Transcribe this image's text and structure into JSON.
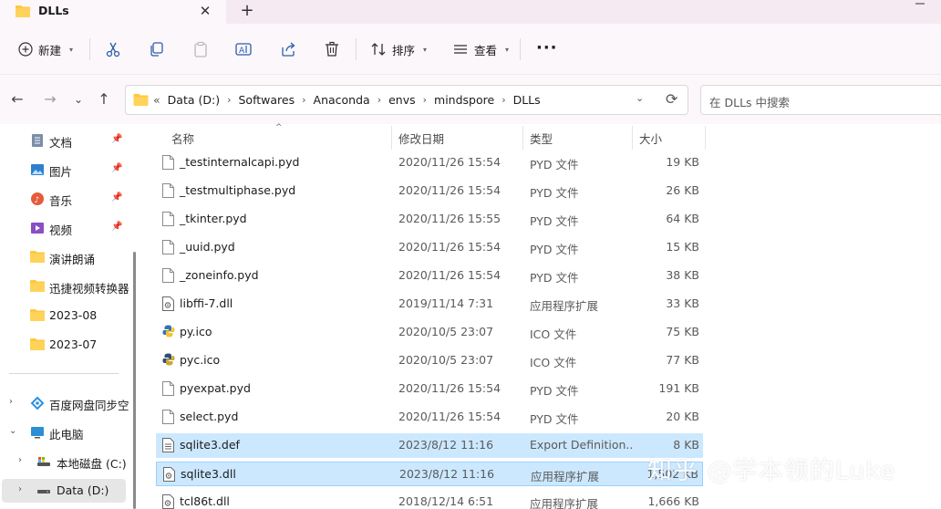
{
  "tab": {
    "title": "DLLs",
    "close": "✕",
    "new_tab": "+"
  },
  "toolbar": {
    "new_label": "新建",
    "sort_label": "排序",
    "view_label": "查看",
    "more": "···"
  },
  "nav": {
    "back": "←",
    "forward": "→",
    "recent": "⌄",
    "up": "↑",
    "prefix": "«",
    "crumbs": [
      "Data (D:)",
      "Softwares",
      "Anaconda",
      "envs",
      "mindspore",
      "DLLs"
    ],
    "search_placeholder": "在 DLLs 中搜索"
  },
  "sidebar": {
    "quick": [
      {
        "label": "文档",
        "icon": "document-icon",
        "pinned": true
      },
      {
        "label": "图片",
        "icon": "pictures-icon",
        "pinned": true
      },
      {
        "label": "音乐",
        "icon": "music-icon",
        "pinned": true
      },
      {
        "label": "视频",
        "icon": "video-icon",
        "pinned": true
      },
      {
        "label": "演讲朗诵",
        "icon": "folder-icon",
        "pinned": false
      },
      {
        "label": "迅捷视频转换器",
        "icon": "folder-icon",
        "pinned": false
      },
      {
        "label": "2023-08",
        "icon": "folder-icon",
        "pinned": false
      },
      {
        "label": "2023-07",
        "icon": "folder-icon",
        "pinned": false
      }
    ],
    "tree": [
      {
        "label": "百度网盘同步空",
        "icon": "baidu-netdisk-icon",
        "expander": "›"
      },
      {
        "label": "此电脑",
        "icon": "this-pc-icon",
        "expander": "⌄"
      },
      {
        "label": "本地磁盘 (C:)",
        "icon": "drive-c-icon",
        "expander": "›"
      },
      {
        "label": "Data (D:)",
        "icon": "drive-d-icon",
        "expander": "›"
      }
    ]
  },
  "columns": {
    "name": "名称",
    "date": "修改日期",
    "type": "类型",
    "size": "大小"
  },
  "files": [
    {
      "name": "_testinternalcapi.pyd",
      "date": "2020/11/26 15:54",
      "type": "PYD 文件",
      "size": "19 KB",
      "icon": "file-icon",
      "state": ""
    },
    {
      "name": "_testmultiphase.pyd",
      "date": "2020/11/26 15:54",
      "type": "PYD 文件",
      "size": "26 KB",
      "icon": "file-icon",
      "state": ""
    },
    {
      "name": "_tkinter.pyd",
      "date": "2020/11/26 15:55",
      "type": "PYD 文件",
      "size": "64 KB",
      "icon": "file-icon",
      "state": ""
    },
    {
      "name": "_uuid.pyd",
      "date": "2020/11/26 15:54",
      "type": "PYD 文件",
      "size": "15 KB",
      "icon": "file-icon",
      "state": ""
    },
    {
      "name": "_zoneinfo.pyd",
      "date": "2020/11/26 15:54",
      "type": "PYD 文件",
      "size": "38 KB",
      "icon": "file-icon",
      "state": ""
    },
    {
      "name": "libffi-7.dll",
      "date": "2019/11/14 7:31",
      "type": "应用程序扩展",
      "size": "33 KB",
      "icon": "dll-icon",
      "state": ""
    },
    {
      "name": "py.ico",
      "date": "2020/10/5 23:07",
      "type": "ICO 文件",
      "size": "75 KB",
      "icon": "python-icon",
      "state": ""
    },
    {
      "name": "pyc.ico",
      "date": "2020/10/5 23:07",
      "type": "ICO 文件",
      "size": "77 KB",
      "icon": "python-dark-icon",
      "state": ""
    },
    {
      "name": "pyexpat.pyd",
      "date": "2020/11/26 15:54",
      "type": "PYD 文件",
      "size": "191 KB",
      "icon": "file-icon",
      "state": ""
    },
    {
      "name": "select.pyd",
      "date": "2020/11/26 15:54",
      "type": "PYD 文件",
      "size": "20 KB",
      "icon": "file-icon",
      "state": ""
    },
    {
      "name": "sqlite3.def",
      "date": "2023/8/12 11:16",
      "type": "Export Definition...",
      "size": "8 KB",
      "icon": "text-file-icon",
      "state": "selected"
    },
    {
      "name": "sqlite3.dll",
      "date": "2023/8/12 11:16",
      "type": "应用程序扩展",
      "size": "1,502 KB",
      "icon": "dll-icon",
      "state": "focused"
    },
    {
      "name": "tcl86t.dll",
      "date": "2018/12/14 6:51",
      "type": "应用程序扩展",
      "size": "1,666 KB",
      "icon": "dll-icon",
      "state": ""
    }
  ],
  "watermark": "知乎 @学本领的Luke",
  "colors": {
    "accent": "#0067c0",
    "selection": "#cce8ff",
    "folder": "#ffc83d"
  }
}
